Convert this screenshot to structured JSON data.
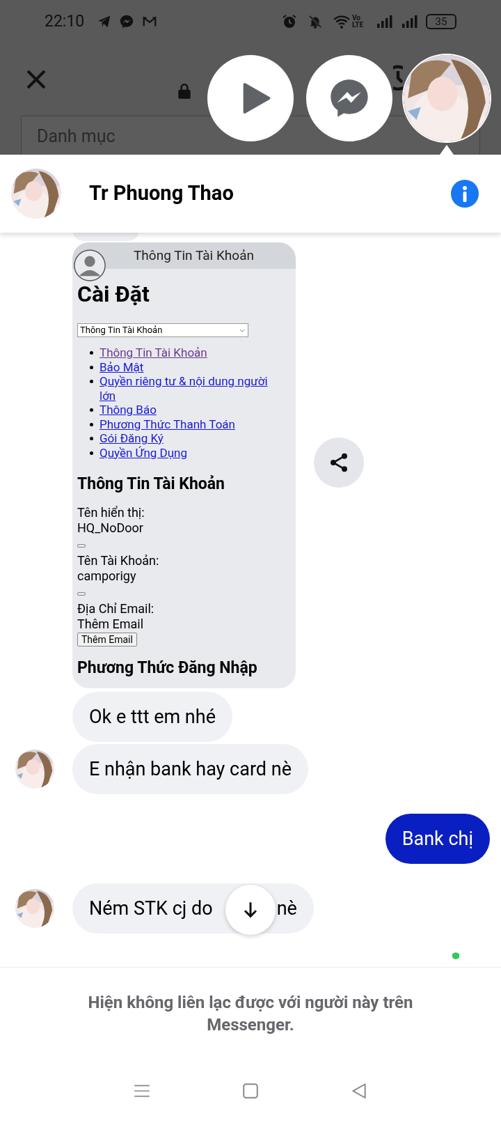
{
  "status_bar": {
    "time": "22:10",
    "network_label": "Vo LTE",
    "battery": "35"
  },
  "browser": {
    "category_field": {
      "placeholder": "Danh mục"
    }
  },
  "chat_heads": [
    {
      "kind": "play"
    },
    {
      "kind": "messenger"
    },
    {
      "kind": "avatar",
      "selected": true
    }
  ],
  "chat": {
    "contact_name": "Tr Phuong Thao",
    "messages": [
      {
        "outgoing": false,
        "show_avatar": false,
        "screenshot": {
          "tab_title": "Thông Tin Tài Khoản",
          "heading": "Cài Đặt",
          "select_value": "Thông Tin Tài Khoản",
          "links": [
            {
              "text": "Thông Tin Tài Khoản",
              "visited": true
            },
            {
              "text": "Bảo Mật",
              "visited": false
            },
            {
              "text": "Quyền riêng tư & nội dung người lớn",
              "visited": false
            },
            {
              "text": "Thông Báo",
              "visited": false
            },
            {
              "text": "Phương Thức Thanh Toán",
              "visited": false
            },
            {
              "text": "Gói Đăng Ký",
              "visited": false
            },
            {
              "text": "Quyền Ứng Dụng",
              "visited": false
            }
          ],
          "section_heading": "Thông Tin Tài Khoản",
          "fields": [
            {
              "label": "Tên hiển thị:",
              "value": "HQ_NoDoor",
              "small_button": true
            },
            {
              "label": "Tên Tài Khoản:",
              "value": "camporigy",
              "small_button": true
            },
            {
              "label": "Địa Chỉ Email:",
              "value": "Thêm Email"
            }
          ],
          "button": "Thêm Email",
          "footer_heading": "Phương Thức Đăng Nhập"
        }
      },
      {
        "kind": "text",
        "outgoing": false,
        "show_avatar": false,
        "parts": [
          "Ok e ttt em nhé"
        ]
      },
      {
        "kind": "text",
        "outgoing": false,
        "show_avatar": true,
        "parts": [
          "E nhận bank hay card nè"
        ]
      },
      {
        "kind": "text",
        "outgoing": true,
        "parts": [
          "Bank chị"
        ]
      },
      {
        "kind": "text",
        "outgoing": false,
        "show_avatar": true,
        "parts": [
          "Ném STK cj do",
          "nè"
        ]
      }
    ],
    "notice": "Hiện không liên lạc được với người này trên Messenger."
  }
}
